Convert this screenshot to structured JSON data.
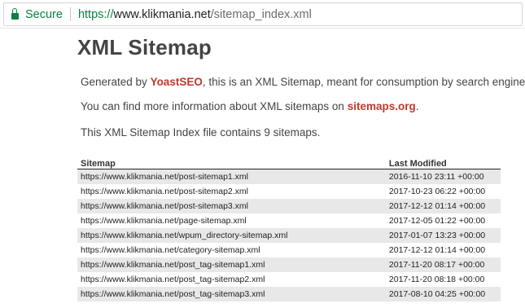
{
  "browser": {
    "security_label": "Secure",
    "url_scheme": "https://",
    "url_host": "www.klikmania.net",
    "url_path": "/sitemap_index.xml"
  },
  "page": {
    "title": "XML Sitemap",
    "intro_prefix": "Generated by ",
    "intro_link": "YoastSEO",
    "intro_suffix": ", this is an XML Sitemap, meant for consumption by search engines.",
    "info_prefix": "You can find more information about XML sitemaps on ",
    "info_link": "sitemaps.org",
    "info_suffix": ".",
    "count_text": "This XML Sitemap Index file contains 9 sitemaps."
  },
  "colors": {
    "secure_green": "#0b8043",
    "link_red": "#c0392b",
    "row_stripe": "#e8e8e8"
  },
  "table": {
    "headers": {
      "sitemap": "Sitemap",
      "last_modified": "Last Modified"
    },
    "rows": [
      {
        "loc": "https://www.klikmania.net/post-sitemap1.xml",
        "lastmod": "2016-11-10 23:11 +00:00"
      },
      {
        "loc": "https://www.klikmania.net/post-sitemap2.xml",
        "lastmod": "2017-10-23 06:22 +00:00"
      },
      {
        "loc": "https://www.klikmania.net/post-sitemap3.xml",
        "lastmod": "2017-12-12 01:14 +00:00"
      },
      {
        "loc": "https://www.klikmania.net/page-sitemap.xml",
        "lastmod": "2017-12-05 01:22 +00:00"
      },
      {
        "loc": "https://www.klikmania.net/wpum_directory-sitemap.xml",
        "lastmod": "2017-01-07 13:23 +00:00"
      },
      {
        "loc": "https://www.klikmania.net/category-sitemap.xml",
        "lastmod": "2017-12-12 01:14 +00:00"
      },
      {
        "loc": "https://www.klikmania.net/post_tag-sitemap1.xml",
        "lastmod": "2017-11-20 08:17 +00:00"
      },
      {
        "loc": "https://www.klikmania.net/post_tag-sitemap2.xml",
        "lastmod": "2017-11-20 08:18 +00:00"
      },
      {
        "loc": "https://www.klikmania.net/post_tag-sitemap3.xml",
        "lastmod": "2017-08-10 04:25 +00:00"
      }
    ]
  }
}
